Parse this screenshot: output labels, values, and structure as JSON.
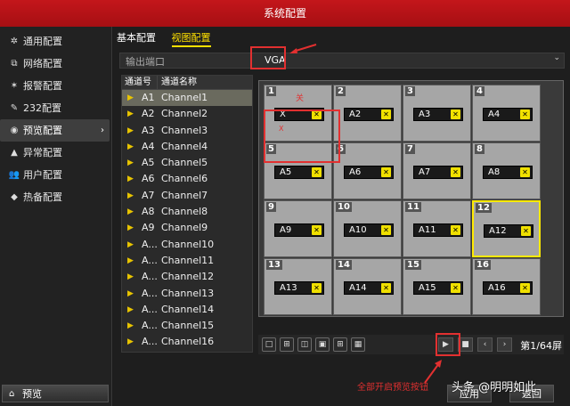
{
  "window": {
    "title": "系统配置"
  },
  "sidebar": {
    "items": [
      {
        "label": "通用配置",
        "icon": "gear-icon"
      },
      {
        "label": "网络配置",
        "icon": "network-icon"
      },
      {
        "label": "报警配置",
        "icon": "alarm-icon"
      },
      {
        "label": "232配置",
        "icon": "pencil-icon"
      },
      {
        "label": "预览配置",
        "icon": "eye-icon",
        "active": true
      },
      {
        "label": "异常配置",
        "icon": "warning-icon"
      },
      {
        "label": "用户配置",
        "icon": "users-icon"
      },
      {
        "label": "热备配置",
        "icon": "hotspare-icon"
      }
    ],
    "bottom_button": "预览"
  },
  "tabs": [
    {
      "label": "基本配置"
    },
    {
      "label": "视图配置",
      "active": true
    }
  ],
  "output_port": {
    "label": "输出端口",
    "value": "VGA"
  },
  "channel_table": {
    "headers": [
      "通道号",
      "通道名称"
    ],
    "rows": [
      {
        "no": "A1",
        "name": "Channel1",
        "selected": true
      },
      {
        "no": "A2",
        "name": "Channel2"
      },
      {
        "no": "A3",
        "name": "Channel3"
      },
      {
        "no": "A4",
        "name": "Channel4"
      },
      {
        "no": "A5",
        "name": "Channel5"
      },
      {
        "no": "A6",
        "name": "Channel6"
      },
      {
        "no": "A7",
        "name": "Channel7"
      },
      {
        "no": "A8",
        "name": "Channel8"
      },
      {
        "no": "A9",
        "name": "Channel9"
      },
      {
        "no": "A...",
        "name": "Channel10"
      },
      {
        "no": "A...",
        "name": "Channel11"
      },
      {
        "no": "A...",
        "name": "Channel12"
      },
      {
        "no": "A...",
        "name": "Channel13"
      },
      {
        "no": "A...",
        "name": "Channel14"
      },
      {
        "no": "A...",
        "name": "Channel15"
      },
      {
        "no": "A...",
        "name": "Channel16"
      }
    ]
  },
  "view_grid": {
    "cells": [
      {
        "num": "1",
        "label": "X"
      },
      {
        "num": "2",
        "label": "A2"
      },
      {
        "num": "3",
        "label": "A3"
      },
      {
        "num": "4",
        "label": "A4"
      },
      {
        "num": "5",
        "label": "A5"
      },
      {
        "num": "6",
        "label": "A6"
      },
      {
        "num": "7",
        "label": "A7"
      },
      {
        "num": "8",
        "label": "A8"
      },
      {
        "num": "9",
        "label": "A9"
      },
      {
        "num": "10",
        "label": "A10"
      },
      {
        "num": "11",
        "label": "A11"
      },
      {
        "num": "12",
        "label": "A12",
        "highlighted": true
      },
      {
        "num": "13",
        "label": "A13"
      },
      {
        "num": "14",
        "label": "A14"
      },
      {
        "num": "15",
        "label": "A15"
      },
      {
        "num": "16",
        "label": "A16"
      }
    ],
    "cell1_annotations": [
      "关",
      "X"
    ]
  },
  "toolbar": {
    "page_label": "第1/64屏"
  },
  "annotation": {
    "text": "全部开启预览按钮"
  },
  "footer": {
    "apply": "应用",
    "back": "返回"
  },
  "watermark": "头条 @明明如此",
  "colors": {
    "title_bar": "#b3121a",
    "accent": "#ffe000",
    "annotation": "#e23030"
  }
}
